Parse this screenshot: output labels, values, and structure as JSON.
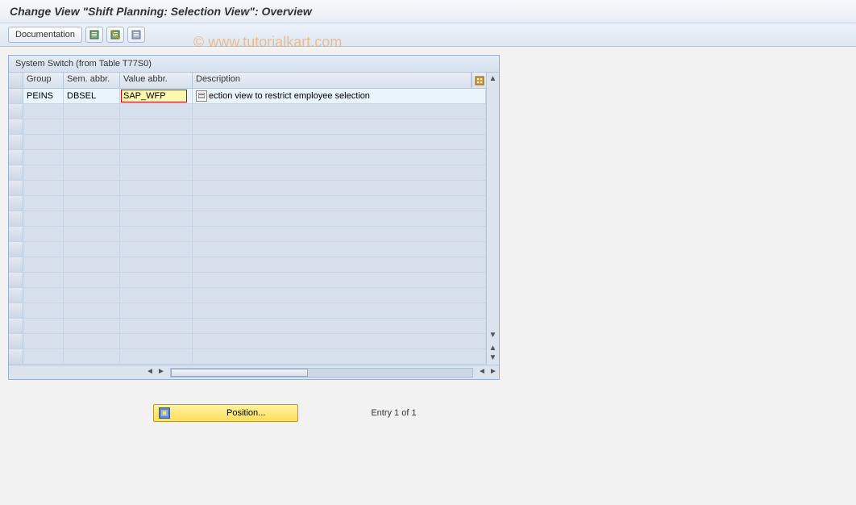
{
  "title": "Change View \"Shift Planning: Selection View\": Overview",
  "toolbar": {
    "documentation_label": "Documentation"
  },
  "watermark": "© www.tutorialkart.com",
  "panel": {
    "header": "System Switch (from Table T77S0)",
    "columns": {
      "group": "Group",
      "sem": "Sem. abbr.",
      "val": "Value abbr.",
      "desc": "Description"
    },
    "rows": [
      {
        "group": "PEINS",
        "sem": "DBSEL",
        "val": "SAP_WFP",
        "desc": "ection view to restrict employee selection"
      }
    ]
  },
  "footer": {
    "position_label": "Position...",
    "entry_text": "Entry 1 of 1"
  }
}
